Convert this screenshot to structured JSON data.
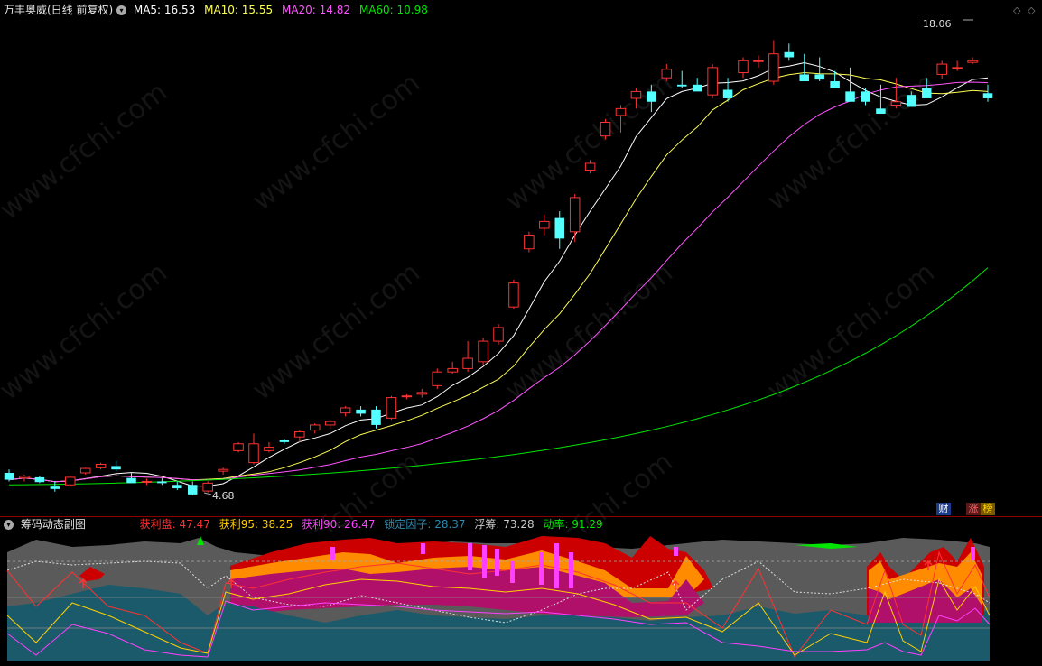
{
  "header": {
    "stock_title": "万丰奥威(日线 前复权)",
    "ma5_label": "MA5: 16.53",
    "ma10_label": "MA10: 15.55",
    "ma20_label": "MA20: 14.82",
    "ma60_label": "MA60: 10.98"
  },
  "colors": {
    "up": "#ff3232",
    "down": "#54ffff",
    "ma5": "#ffffff",
    "ma10": "#ffff54",
    "ma20": "#ff54ff",
    "ma60": "#00e600",
    "divider": "#8b0000"
  },
  "annotations": {
    "high_label": "18.06",
    "low_label": "4.68"
  },
  "badges": {
    "cai": "财",
    "zhang": "涨",
    "bang": "榜"
  },
  "watermark": "www.cfchi.com",
  "sub_header": {
    "title": "筹码动态副图",
    "profit_label": "获利盘: 47.47",
    "profit95_label": "获利95: 38.25",
    "profit90_label": "获利90: 26.47",
    "lock_label": "锁定因子: 28.37",
    "float_label": "浮筹: 73.28",
    "momentum_label": "动率: 91.29"
  },
  "candles": [
    [
      5.25,
      5.35,
      5.0,
      5.05
    ],
    [
      5.1,
      5.2,
      5.0,
      5.15
    ],
    [
      5.12,
      5.15,
      4.95,
      4.98
    ],
    [
      4.85,
      5.0,
      4.7,
      4.78
    ],
    [
      4.9,
      5.18,
      4.85,
      5.12
    ],
    [
      5.25,
      5.4,
      5.2,
      5.38
    ],
    [
      5.4,
      5.55,
      5.35,
      5.5
    ],
    [
      5.45,
      5.6,
      5.3,
      5.35
    ],
    [
      5.1,
      5.25,
      5.0,
      4.95
    ],
    [
      5.0,
      5.08,
      4.9,
      5.0
    ],
    [
      5.0,
      5.1,
      4.9,
      4.95
    ],
    [
      4.9,
      5.0,
      4.75,
      4.8
    ],
    [
      4.9,
      5.0,
      4.6,
      4.62
    ],
    [
      4.72,
      5.0,
      4.68,
      4.95
    ],
    [
      5.3,
      5.4,
      5.2,
      5.35
    ],
    [
      5.9,
      6.15,
      5.85,
      6.1
    ],
    [
      5.55,
      6.4,
      5.5,
      6.1
    ],
    [
      5.9,
      6.15,
      5.85,
      6.0
    ],
    [
      6.2,
      6.25,
      6.1,
      6.15
    ],
    [
      6.3,
      6.5,
      6.15,
      6.45
    ],
    [
      6.5,
      6.7,
      6.4,
      6.65
    ],
    [
      6.65,
      6.8,
      6.55,
      6.75
    ],
    [
      7.0,
      7.2,
      6.9,
      7.15
    ],
    [
      7.1,
      7.2,
      6.9,
      6.98
    ],
    [
      7.1,
      7.2,
      6.55,
      6.65
    ],
    [
      6.85,
      7.5,
      6.8,
      7.45
    ],
    [
      7.5,
      7.55,
      7.4,
      7.5
    ],
    [
      7.55,
      7.7,
      7.45,
      7.6
    ],
    [
      7.8,
      8.3,
      7.7,
      8.2
    ],
    [
      8.2,
      8.5,
      8.15,
      8.3
    ],
    [
      8.3,
      9.1,
      8.2,
      8.6
    ],
    [
      8.5,
      9.2,
      8.4,
      9.1
    ],
    [
      9.1,
      9.6,
      9.0,
      9.5
    ],
    [
      10.1,
      10.9,
      10.05,
      10.8
    ],
    [
      11.8,
      12.3,
      11.7,
      12.2
    ],
    [
      12.4,
      12.8,
      12.2,
      12.6
    ],
    [
      12.7,
      12.9,
      11.8,
      12.1
    ],
    [
      12.3,
      13.4,
      12.0,
      13.3
    ],
    [
      14.1,
      14.4,
      14.0,
      14.3
    ],
    [
      15.1,
      15.6,
      15.0,
      15.5
    ],
    [
      15.7,
      16.0,
      15.2,
      15.9
    ],
    [
      16.2,
      16.5,
      15.9,
      16.4
    ],
    [
      16.4,
      16.6,
      15.8,
      16.1
    ],
    [
      16.8,
      17.2,
      16.7,
      17.05
    ],
    [
      16.6,
      17.0,
      16.5,
      16.55
    ],
    [
      16.6,
      16.8,
      16.5,
      16.4
    ],
    [
      16.3,
      17.2,
      16.2,
      17.1
    ],
    [
      16.45,
      16.8,
      16.1,
      16.2
    ],
    [
      16.95,
      17.4,
      16.8,
      17.3
    ],
    [
      17.3,
      17.45,
      17.1,
      17.3
    ],
    [
      16.7,
      17.9,
      16.6,
      17.5
    ],
    [
      17.55,
      17.8,
      17.3,
      17.4
    ],
    [
      16.9,
      17.5,
      16.8,
      16.7
    ],
    [
      16.9,
      17.4,
      16.7,
      16.75
    ],
    [
      16.7,
      17.0,
      16.6,
      16.5
    ],
    [
      16.4,
      17.1,
      16.2,
      16.1
    ],
    [
      16.4,
      16.5,
      16.0,
      16.1
    ],
    [
      15.9,
      16.6,
      15.8,
      15.75
    ],
    [
      16.0,
      16.8,
      15.9,
      16.1
    ],
    [
      16.3,
      16.4,
      16.0,
      15.95
    ],
    [
      16.5,
      16.8,
      16.3,
      16.2
    ],
    [
      16.9,
      17.3,
      16.75,
      17.2
    ],
    [
      17.1,
      17.3,
      17.0,
      17.1
    ],
    [
      17.25,
      17.4,
      17.2,
      17.3
    ],
    [
      16.35,
      16.6,
      16.1,
      16.2
    ]
  ]
}
